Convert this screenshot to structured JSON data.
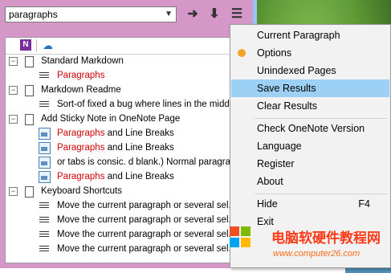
{
  "search": {
    "value": "paragraphs"
  },
  "toolbar": {
    "go": "go-arrow-icon",
    "down": "download-icon",
    "menu": "hamburger-menu-icon"
  },
  "tabs": [
    {
      "label": "N"
    }
  ],
  "results": [
    {
      "type": "page",
      "text": "Standard Markdown"
    },
    {
      "type": "para",
      "text": "Paragraphs",
      "red": true
    },
    {
      "type": "page",
      "text": "Markdown Readme"
    },
    {
      "type": "para",
      "text": "Sort-of fixed a bug where lines in the midd..."
    },
    {
      "type": "page",
      "text": "Add Sticky Note in OneNote Page"
    },
    {
      "type": "img",
      "hl": "Paragraphs",
      "rest": " and Line Breaks"
    },
    {
      "type": "img",
      "hl": "Paragraphs",
      "rest": " and Line Breaks"
    },
    {
      "type": "img",
      "hl": "",
      "rest": "or tabs is consic. d blank.) Normal paragra..."
    },
    {
      "type": "img",
      "hl": "Paragraphs",
      "rest": " and Line Breaks"
    },
    {
      "type": "page",
      "text": "Keyboard Shortcuts"
    },
    {
      "type": "para",
      "text": "Move the current paragraph or several sel..."
    },
    {
      "type": "para",
      "text": "Move the current paragraph or several sel..."
    },
    {
      "type": "para",
      "text": "Move the current paragraph or several sel..."
    },
    {
      "type": "para",
      "text": "Move the current paragraph or several sel..."
    }
  ],
  "menu": {
    "current_paragraph": "Current Paragraph",
    "options": "Options",
    "unindexed_pages": "Unindexed Pages",
    "save_results": "Save Results",
    "clear_results": "Clear Results",
    "check_version": "Check OneNote Version",
    "language": "Language",
    "register": "Register",
    "about": "About",
    "hide": "Hide",
    "hide_shortcut": "F4",
    "exit": "Exit"
  },
  "watermark": {
    "title": "电脑软硬件教程网",
    "url": "www.computer26.com"
  }
}
